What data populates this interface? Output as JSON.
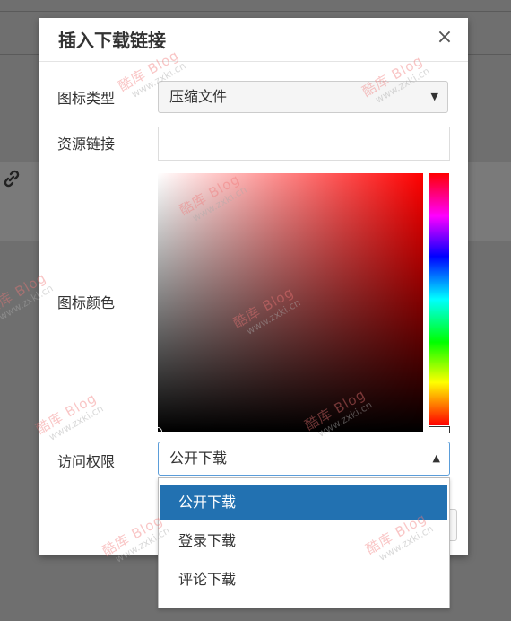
{
  "dialog": {
    "title": "插入下载链接",
    "close_label": "×",
    "fields": {
      "icon_type": {
        "label": "图标类型",
        "value": "压缩文件",
        "arrow": "▼"
      },
      "resource_link": {
        "label": "资源链接",
        "value": "",
        "placeholder": ""
      },
      "icon_color": {
        "label": "图标颜色",
        "hue": "#ff0000"
      },
      "access": {
        "label": "访问权限",
        "value": "公开下载",
        "arrow": "▲"
      }
    }
  },
  "access_dropdown": {
    "options": [
      "公开下载",
      "登录下载",
      "评论下载"
    ],
    "selected_index": 0
  },
  "watermark": {
    "brand": "酷库 Blog",
    "url": "www.zxki.cn"
  },
  "colors": {
    "accent": "#2271b1",
    "overlay": "#6f6f6f"
  }
}
